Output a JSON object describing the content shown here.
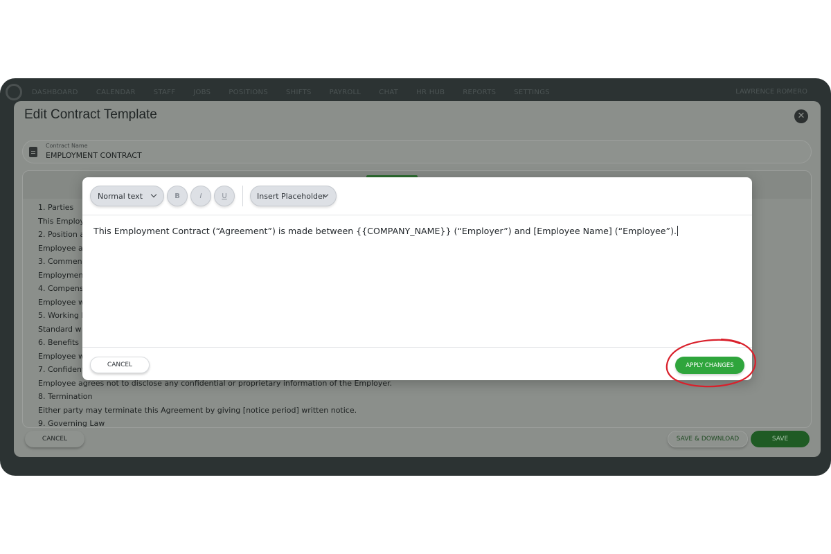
{
  "topnav": {
    "items": [
      "DASHBOARD",
      "CALENDAR",
      "STAFF",
      "JOBS",
      "POSITIONS",
      "SHIFTS",
      "PAYROLL",
      "CHAT",
      "HR HUB",
      "REPORTS",
      "SETTINGS"
    ],
    "account": "LAWRENCE ROMERO"
  },
  "edit_template": {
    "title": "Edit Contract Template",
    "contract_name_label": "Contract Name",
    "contract_name_value": "EMPLOYMENT CONTRACT",
    "document_lines": [
      "1. Parties",
      "This Employ",
      "2. Position a",
      "Employee a",
      "3. Commenc",
      "Employmen",
      "4. Compens",
      "Employee w",
      "5. Working H",
      "Standard w",
      "6. Benefits",
      "Employee w",
      "7. Confident",
      "Employee agrees not to disclose any confidential or proprietary information of the Employer.",
      "8. Termination",
      "Either party may terminate this Agreement by giving [notice period] written notice.",
      "9. Governing Law"
    ],
    "cancel_label": "CANCEL",
    "save_download_label": "SAVE & DOWNLOAD",
    "save_label": "SAVE"
  },
  "editor_modal": {
    "text_style": "Normal text",
    "bold_label": "B",
    "italic_label": "I",
    "underline_label": "U",
    "insert_placeholder_label": "Insert Placeholder",
    "content": "This Employment Contract (“Agreement”) is made between {{COMPANY_NAME}} (“Employer”) and [Employee Name] (“Employee”).",
    "cancel_label": "CANCEL",
    "apply_label": "APPLY CHANGES"
  },
  "colors": {
    "apply_green": "#2fa53c",
    "annotation_red": "#d9202b",
    "frame_dark": "#2c3333"
  }
}
